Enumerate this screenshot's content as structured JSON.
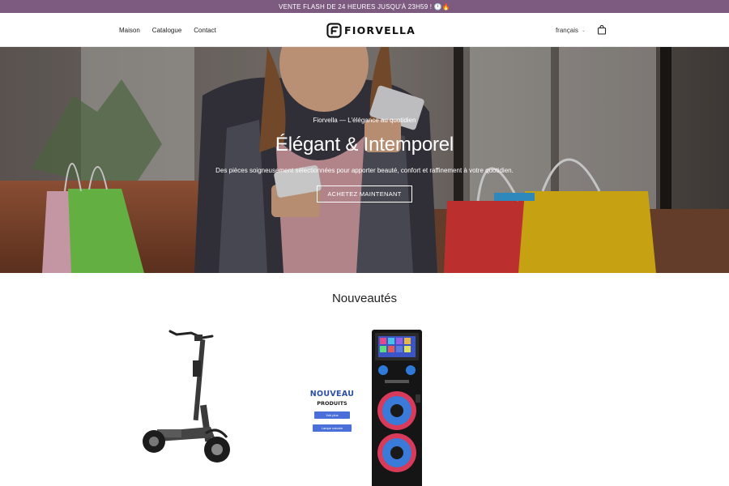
{
  "announcement": {
    "text": "VENTE FLASH DE 24 HEURES JUSQU'À 23H59 ! 🕛🔥"
  },
  "header": {
    "nav": [
      "Maison",
      "Catalogue",
      "Contact"
    ],
    "logo_text": "FIORVELLA",
    "language": "français"
  },
  "hero": {
    "subtitle": "Fiorvella — L'élégance au quotidien",
    "title": "Élégant & Intemporel",
    "description": "Des pièces soigneusement sélectionnées pour apporter beauté, confort et raffinement à votre quotidien.",
    "cta": "ACHETEZ MAINTENANT"
  },
  "section": {
    "title": "Nouveautés"
  },
  "products": {
    "promo_title": "NOUVEAU",
    "promo_subtitle": "PRODUITS",
    "promo_btn1": "Voir plus",
    "promo_btn2": "Lampe colorée"
  },
  "colors": {
    "announcement_bg": "#7d5a80",
    "accent_blue": "#4a6fd8"
  },
  "icons": [
    "logo-icon",
    "chevron-down-icon",
    "shopping-bag-icon"
  ]
}
